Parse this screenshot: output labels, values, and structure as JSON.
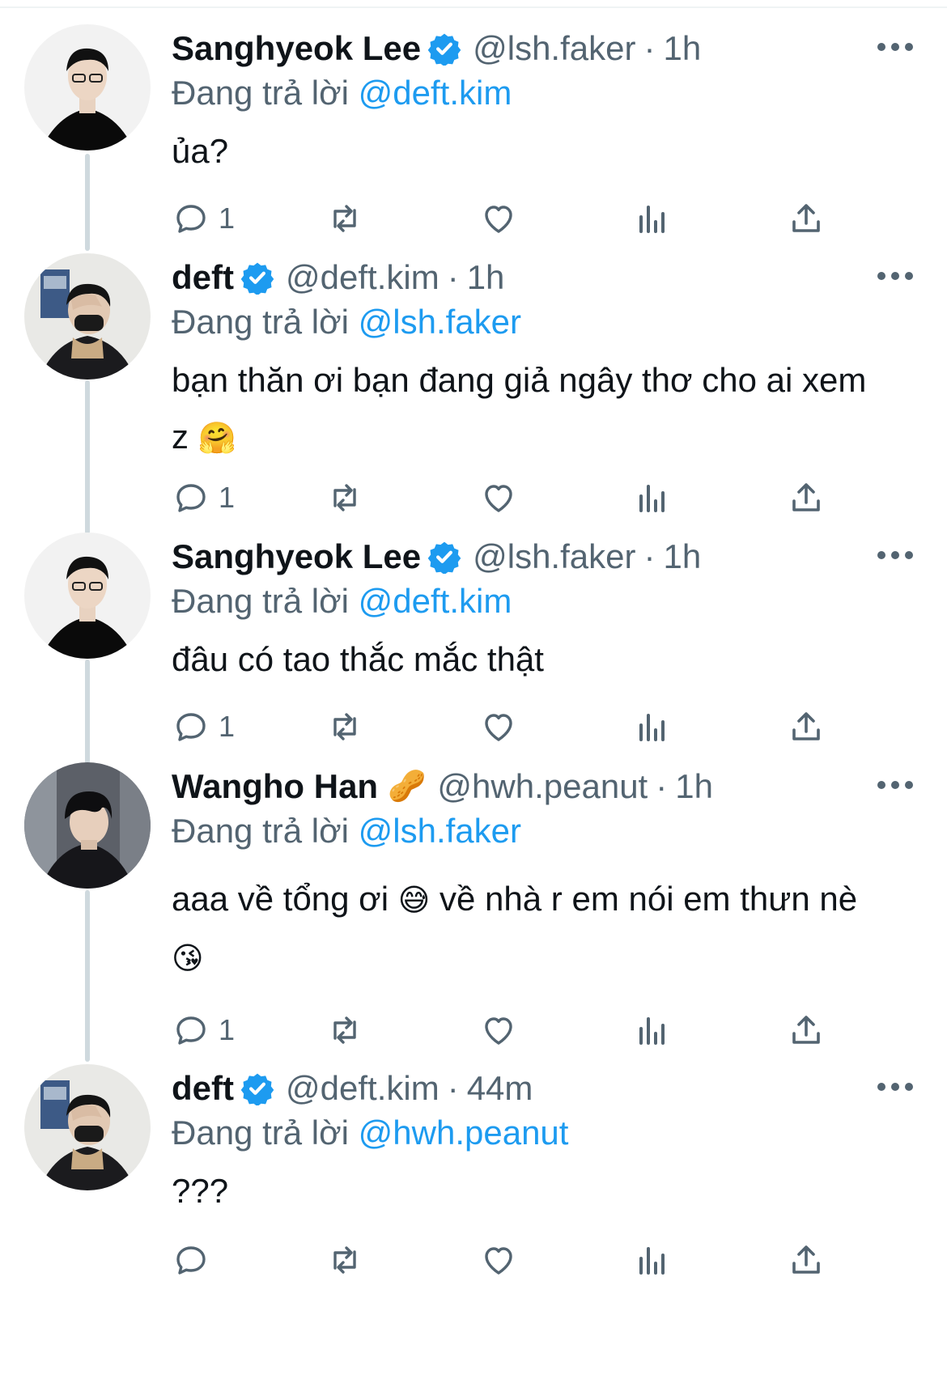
{
  "reply_prefix": "Đang trả lời",
  "tweets": [
    {
      "name": "Sanghyeok Lee",
      "verified": true,
      "handle": "@lsh.faker",
      "separator": "·",
      "time": "1h",
      "reply_to": "@deft.kim",
      "text_line1": "ủa?",
      "text_line2": "",
      "reply_count": "1",
      "avatar": "faker-avatar"
    },
    {
      "name": "deft",
      "verified": true,
      "handle": "@deft.kim",
      "separator": "·",
      "time": "1h",
      "reply_to": "@lsh.faker",
      "text_line1": "bạn thăn ơi bạn đang giả ngây thơ cho ai xem",
      "text_line2": "z",
      "emoji_line2": "🤗",
      "reply_count": "1",
      "avatar": "deft-avatar"
    },
    {
      "name": "Sanghyeok Lee",
      "verified": true,
      "handle": "@lsh.faker",
      "separator": "·",
      "time": "1h",
      "reply_to": "@deft.kim",
      "text_line1": "đâu có tao thắc mắc thật",
      "text_line2": "",
      "reply_count": "1",
      "avatar": "faker-avatar"
    },
    {
      "name": "Wangho Han",
      "verified": false,
      "name_emoji": "🥜",
      "handle": "@hwh.peanut",
      "separator": "·",
      "time": "1h",
      "reply_to": "@lsh.faker",
      "text_line1_a": "aaa về tổng ơi",
      "emoji_line1": "😅",
      "text_line1_b": "về nhà r em nói em thưn nè",
      "emoji_line2": "😘",
      "reply_count": "1",
      "avatar": "peanut-avatar"
    },
    {
      "name": "deft",
      "verified": true,
      "handle": "@deft.kim",
      "separator": "·",
      "time": "44m",
      "reply_to": "@hwh.peanut",
      "text_line1": "???",
      "text_line2": "",
      "reply_count": "",
      "avatar": "deft-avatar"
    }
  ],
  "colors": {
    "accent": "#1d9bf0",
    "secondary_text": "#536471",
    "thread_line": "#cfd9de"
  }
}
